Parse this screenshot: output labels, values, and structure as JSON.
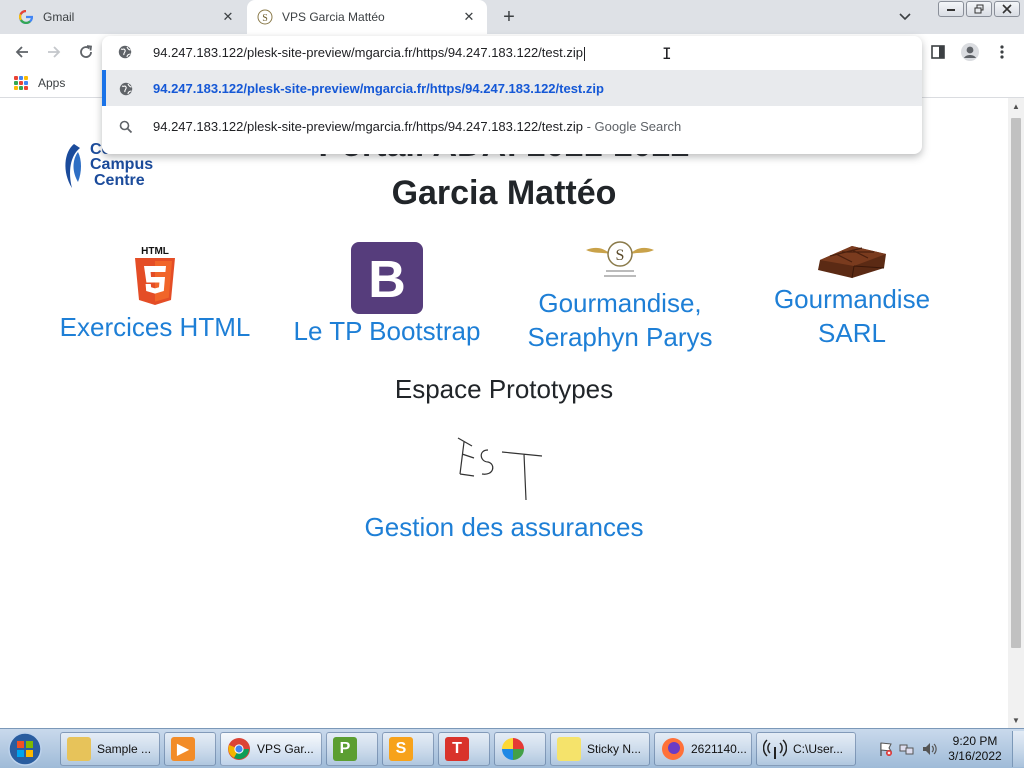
{
  "browser": {
    "tabs": [
      {
        "title": "Gmail",
        "active": false
      },
      {
        "title": "VPS Garcia Mattéo",
        "active": true
      }
    ],
    "address": "94.247.183.122/plesk-site-preview/mgarcia.fr/https/94.247.183.122/test.zip",
    "suggestions": [
      {
        "text": "94.247.183.122/plesk-site-preview/mgarcia.fr/https/94.247.183.122/test.zip",
        "hint": "",
        "icon": "globe-icon"
      },
      {
        "text": "94.247.183.122/plesk-site-preview/mgarcia.fr/https/94.247.183.122/test.zip",
        "hint": " - Google Search",
        "icon": "search-icon"
      }
    ],
    "bookmarks": {
      "apps_label": "Apps"
    }
  },
  "page": {
    "title_line1": "Portail ADA: 2021-2022",
    "title_line2": "Garcia Mattéo",
    "logo": {
      "line1": "Cci",
      "line2": "Campus",
      "line3": "Centre"
    },
    "cards": [
      {
        "label_lines": [
          "Exercices HTML"
        ],
        "icon": "html5-logo-icon",
        "icon_text": "HTML"
      },
      {
        "label_lines": [
          "Le TP Bootstrap"
        ],
        "icon": "bootstrap-logo-icon",
        "icon_text": "B"
      },
      {
        "label_lines": [
          "Gourmandise,",
          "Seraphyn Parys"
        ],
        "icon": "gourmandise-logo-icon",
        "icon_text": "S"
      },
      {
        "label_lines": [
          "Gourmandise",
          "SARL"
        ],
        "icon": "chocolate-icon"
      }
    ],
    "prototypes_heading": "Espace Prototypes",
    "test_sketch_text": "TEST",
    "gestion_link": "Gestion des assurances"
  },
  "taskbar": {
    "items": [
      {
        "label": "Sample ...",
        "icon": "folder-icon"
      },
      {
        "label": "",
        "icon": "media-player-icon"
      },
      {
        "label": "VPS Gar...",
        "icon": "chrome-icon",
        "active": true
      },
      {
        "label": "",
        "icon": "publisher-icon",
        "letter": "P"
      },
      {
        "label": "",
        "icon": "sway-icon",
        "letter": "S"
      },
      {
        "label": "",
        "icon": "tasks-icon",
        "letter": "T"
      },
      {
        "label": "",
        "icon": "pinwheel-icon"
      },
      {
        "label": "Sticky N...",
        "icon": "sticky-notes-icon"
      },
      {
        "label": "2621140...",
        "icon": "firefox-icon"
      },
      {
        "label": "C:\\User...",
        "icon": "network-icon"
      }
    ],
    "time": "9:20 PM",
    "date": "3/16/2022"
  },
  "colors": {
    "link": "#1e7fd6",
    "omni_selected_bar": "#1a73e8",
    "tabstrip": "#dee1e6"
  }
}
